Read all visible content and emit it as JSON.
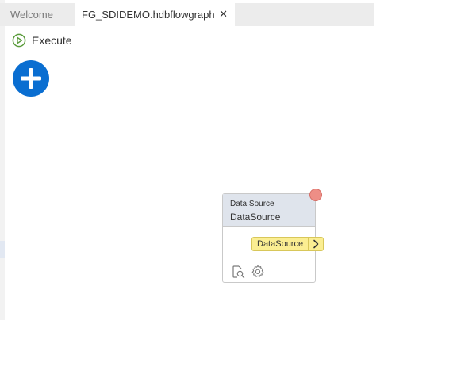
{
  "tabs": [
    {
      "label": "Welcome",
      "active": false
    },
    {
      "label": "FG_SDIDEMO.hdbflowgraph",
      "active": true,
      "close_icon": "close-icon"
    }
  ],
  "tab_close_glyph": "✕",
  "toolbar": {
    "execute_label": "Execute",
    "execute_icon": "play-circle-icon",
    "add_icon": "plus-circle-icon"
  },
  "node": {
    "type_label": "Data Source",
    "name": "DataSource",
    "status": "error",
    "output_port_label": "DataSource",
    "tools": [
      "preview-icon",
      "settings-icon"
    ]
  },
  "colors": {
    "execute_green": "#5a9b3b",
    "add_blue": "#0a6ed1",
    "node_header": "#dfe4ec",
    "status_red": "#ee8e86",
    "port_yellow": "#fbee92"
  }
}
